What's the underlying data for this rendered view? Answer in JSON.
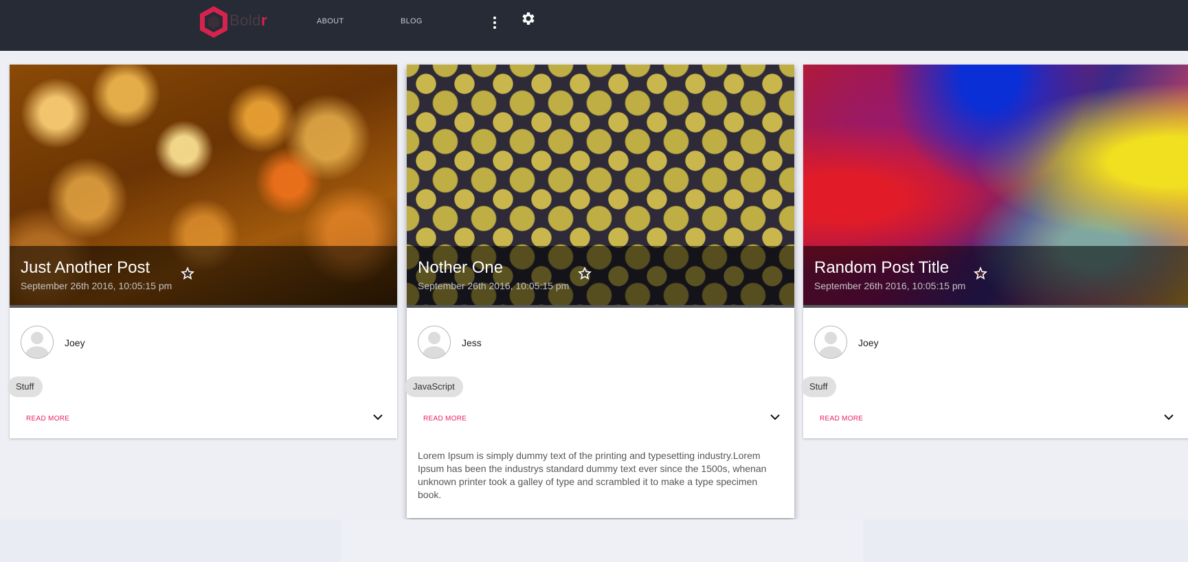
{
  "brand": {
    "name_prefix": "Bold",
    "name_suffix": "r",
    "accent": "#d6234e"
  },
  "nav": {
    "about": "ABOUT",
    "blog": "BLOG"
  },
  "colors": {
    "topbar": "#262b36",
    "page_bg": "#edeff5",
    "read_more": "#e91e63"
  },
  "posts": [
    {
      "title": "Just Another Post",
      "date": "September 26th 2016, 10:05:15 pm",
      "author": "Joey",
      "tag": "Stuff",
      "read_more": "READ MORE",
      "image": "golden bokeh lights"
    },
    {
      "title": "Nother One",
      "date": "September 26th 2016, 10:05:15 pm",
      "author": "Jess",
      "tag": "JavaScript",
      "read_more": "READ MORE",
      "image": "gold and dark pattern",
      "body": "Lorem Ipsum is simply dummy text of the printing and typesetting industry.Lorem Ipsum has been the industrys standard dummy text ever since the 1500s, whenan unknown printer took a galley of type and scrambled it to make a type specimen book."
    },
    {
      "title": "Random Post Title",
      "date": "September 26th 2016, 10:05:15 pm",
      "author": "Joey",
      "tag": "Stuff",
      "read_more": "READ MORE",
      "image": "colorful blur"
    }
  ],
  "icons": [
    "logo-hexagon-icon",
    "more-vert-icon",
    "gear-icon",
    "star-outline-icon",
    "avatar-icon",
    "chevron-down-icon"
  ]
}
